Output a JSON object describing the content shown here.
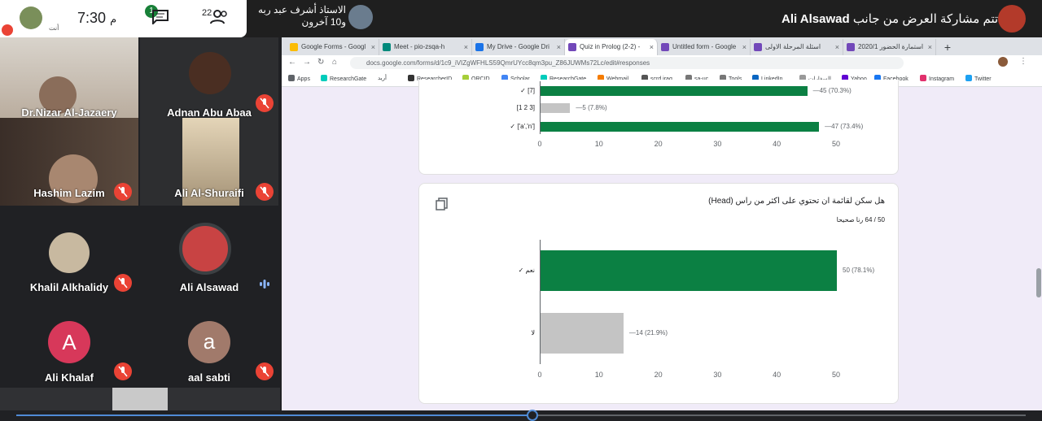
{
  "status": {
    "time": "7:30",
    "ampm": "م",
    "self_name": "أنت",
    "chat_badge": "1",
    "participants": "22"
  },
  "pinned": {
    "line1": "الاستاذ أشرف عبد ربه",
    "line2": "و10 آخرون"
  },
  "presenting": {
    "text": "تتم مشاركة العرض من جانب",
    "name": "Ali Alsawad"
  },
  "participants": [
    {
      "name": "Dr.Nizar Al-Jazaery"
    },
    {
      "name": "Adnan Abu Abaa"
    },
    {
      "name": "Hashim Lazim"
    },
    {
      "name": "Ali Al-Shuraifi"
    },
    {
      "name": "Khalil Alkhalidy"
    },
    {
      "name": "Ali Alsawad"
    },
    {
      "name": "Ali Khalaf",
      "initial": "A"
    },
    {
      "name": "aal sabti",
      "initial": "a"
    }
  ],
  "browser": {
    "tabs": [
      {
        "label": "Google Forms - Googl",
        "color": "#7248b9"
      },
      {
        "label": "Meet - pio-zsqa-h",
        "color": "#00897b"
      },
      {
        "label": "My Drive - Google Dri",
        "color": "#fbbc04"
      },
      {
        "label": "Quiz in Prolog (2-2) - ",
        "color": "#7248b9"
      },
      {
        "label": "Untitled form - Google",
        "color": "#7248b9"
      },
      {
        "label": "اسئلة المرحلة الاولى",
        "color": "#7248b9"
      },
      {
        "label": "استمارة الحضور 2020/1",
        "color": "#7248b9"
      }
    ],
    "url": "docs.google.com/forms/d/1c9_iVIZgWFHLS59QmrUYcc8qm3pu_Z86JUWMs72Lc/edit#responses",
    "bookmarks": [
      "Apps",
      "ResearchGate",
      "أريد",
      "ResearcherID",
      "ORCID",
      "Scholar",
      "ResearchGate",
      "Webmail",
      "scrd iraq",
      "sa-uc",
      "Tools",
      "LinkedIn",
      "السفارات",
      "Yahoo",
      "Facebook",
      "Instagram",
      "Twitter"
    ]
  },
  "chart_data": [
    {
      "type": "bar",
      "orientation": "horizontal",
      "categories": [
        "[7]",
        "[1 2 3]",
        "['a','n']"
      ],
      "correct": [
        true,
        false,
        true
      ],
      "values": [
        45,
        5,
        47
      ],
      "labels": [
        "45 (70.3%)",
        "5 (7.8%)",
        "47 (73.4%)"
      ],
      "xticks": [
        "0",
        "10",
        "20",
        "30",
        "40",
        "50"
      ],
      "xlim": [
        0,
        50
      ]
    },
    {
      "type": "bar",
      "orientation": "horizontal",
      "title": "هل سكن لقائمة ان تحتوي على اكثر من راس (Head)",
      "subtitle": "50 / 64 رنا صحيحا",
      "categories": [
        "نعم",
        "لا"
      ],
      "correct": [
        true,
        false
      ],
      "values": [
        50,
        14
      ],
      "labels": [
        "50 (78.1%)",
        "14 (21.9%)"
      ],
      "xticks": [
        "0",
        "10",
        "20",
        "30",
        "40",
        "50"
      ],
      "xlim": [
        0,
        50
      ]
    }
  ]
}
